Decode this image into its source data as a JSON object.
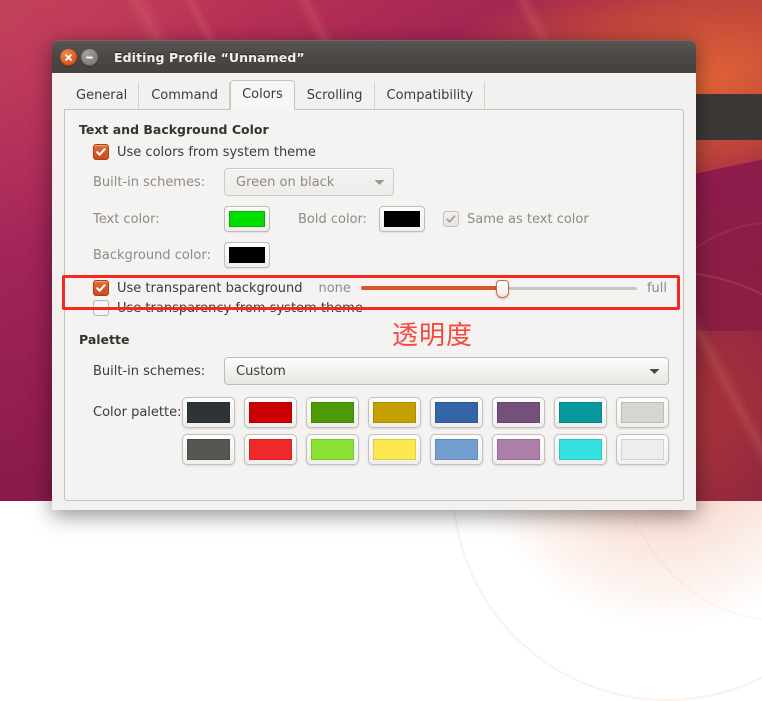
{
  "window": {
    "title": "Editing Profile “Unnamed”",
    "close_icon": "close-icon",
    "minimize_icon": "minimize-icon"
  },
  "tabs": [
    {
      "label": "General",
      "active": false
    },
    {
      "label": "Command",
      "active": false
    },
    {
      "label": "Colors",
      "active": true
    },
    {
      "label": "Scrolling",
      "active": false
    },
    {
      "label": "Compatibility",
      "active": false
    }
  ],
  "text_background_section": {
    "heading": "Text and Background Color",
    "use_system_theme": {
      "label": "Use colors from system theme",
      "checked": true,
      "enabled": true
    },
    "builtin_schemes": {
      "label": "Built-in schemes:",
      "value": "Green on black",
      "enabled": false,
      "caret": "chevron-down-icon"
    },
    "text_color": {
      "label": "Text color:",
      "value": "#00e000"
    },
    "bold_color": {
      "label": "Bold color:",
      "value": "#000000"
    },
    "same_as_text": {
      "label": "Same as text color",
      "checked": true,
      "enabled": false
    },
    "background_color": {
      "label": "Background color:",
      "value": "#000000"
    }
  },
  "transparency": {
    "use_transparent_background": {
      "label": "Use transparent background",
      "checked": true
    },
    "use_transparency_from_system_theme": {
      "label": "Use transparency from system theme",
      "checked": false
    },
    "slider": {
      "min_label": "none",
      "max_label": "full",
      "value_percent": 51
    }
  },
  "palette_section": {
    "heading": "Palette",
    "builtin_schemes": {
      "label": "Built-in schemes:",
      "value": "Custom",
      "enabled": true,
      "caret": "chevron-down-icon"
    },
    "color_palette_label": "Color palette:",
    "palette_colors": [
      [
        "#2e3436",
        "#cc0000",
        "#4e9a06",
        "#c4a000",
        "#3465a4",
        "#75507b",
        "#06989a",
        "#d3d7cf"
      ],
      [
        "#555753",
        "#ef2929",
        "#8ae234",
        "#fce94f",
        "#729fcf",
        "#ad7fa8",
        "#34e2e2",
        "#eeeeec"
      ]
    ]
  },
  "annotation": {
    "text": "透明度",
    "color": "#f4493e",
    "highlight_color": "#f42a20"
  }
}
